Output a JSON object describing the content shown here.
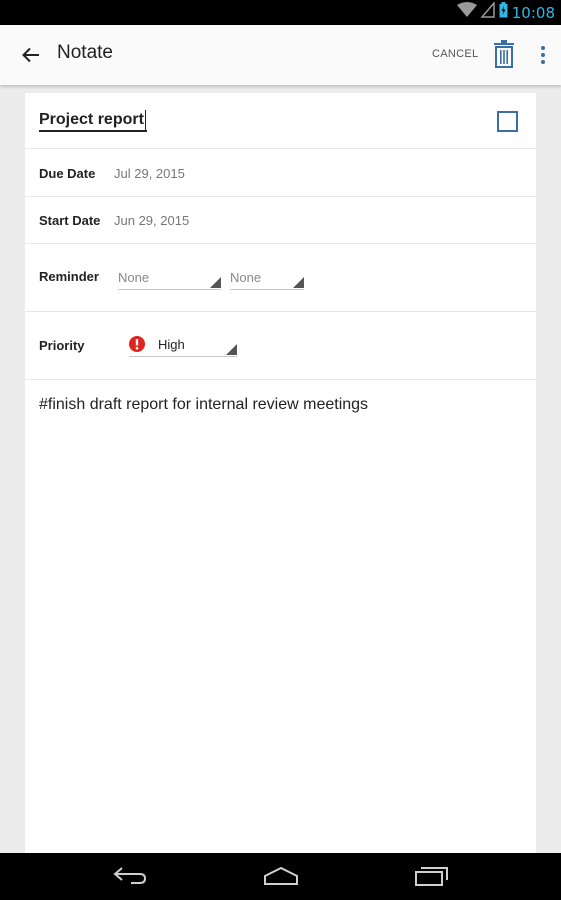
{
  "status_bar": {
    "time": "10:08"
  },
  "app_bar": {
    "title": "Notate",
    "cancel_label": "CANCEL"
  },
  "task": {
    "title": "Project report",
    "completed": false,
    "due_date": {
      "label": "Due Date",
      "value": "Jul 29, 2015"
    },
    "start_date": {
      "label": "Start Date",
      "value": "Jun 29, 2015"
    },
    "reminder": {
      "label": "Reminder",
      "first_value": "None",
      "second_value": "None"
    },
    "priority": {
      "label": "Priority",
      "value": "High",
      "icon": "exclamation-icon",
      "color": "#e0231c"
    },
    "note": "#finish draft report for internal review meetings"
  },
  "colors": {
    "status_clock": "#33b5e5",
    "checkbox_border": "#3a6ea5",
    "trash_icon": "#3a6ea5"
  }
}
